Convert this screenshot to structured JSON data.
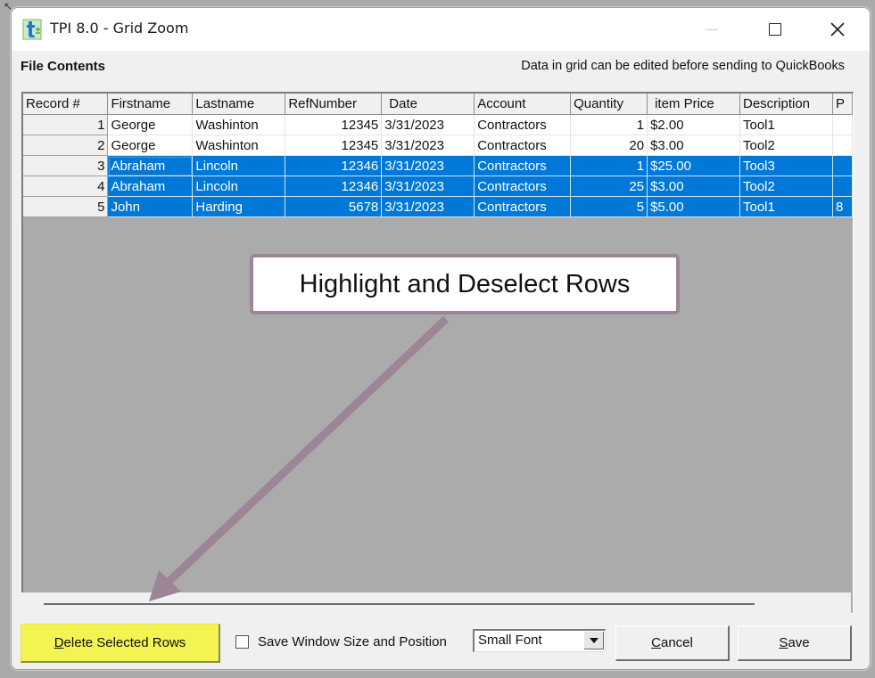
{
  "window": {
    "title": "TPI 8.0 - Grid Zoom",
    "icons": {
      "app": "tpi-app-icon",
      "minimize": "minimize-icon",
      "maximize": "maximize-icon",
      "close": "close-icon"
    },
    "close_glyph": "✕"
  },
  "header": {
    "heading": "File Contents",
    "note": "Data in grid can be edited before sending to QuickBooks"
  },
  "grid": {
    "columns": [
      "Record #",
      "Firstname",
      "Lastname",
      "RefNumber",
      "Date",
      "Account",
      "Quantity",
      "item Price",
      "Description",
      "P"
    ],
    "rows": [
      {
        "record": "1",
        "firstname": "George",
        "lastname": "Washinton",
        "refnumber": "12345",
        "date": "3/31/2023",
        "account": "Contractors",
        "quantity": "1",
        "price": "$2.00",
        "description": "Tool1",
        "p": "",
        "selected": false
      },
      {
        "record": "2",
        "firstname": "George",
        "lastname": "Washinton",
        "refnumber": "12345",
        "date": "3/31/2023",
        "account": "Contractors",
        "quantity": "20",
        "price": "$3.00",
        "description": "Tool2",
        "p": "",
        "selected": false
      },
      {
        "record": "3",
        "firstname": "Abraham",
        "lastname": "Lincoln",
        "refnumber": "12346",
        "date": "3/31/2023",
        "account": "Contractors",
        "quantity": "1",
        "price": "$25.00",
        "description": "Tool3",
        "p": "",
        "selected": true
      },
      {
        "record": "4",
        "firstname": "Abraham",
        "lastname": "Lincoln",
        "refnumber": "12346",
        "date": "3/31/2023",
        "account": "Contractors",
        "quantity": "25",
        "price": "$3.00",
        "description": "Tool2",
        "p": "",
        "selected": true
      },
      {
        "record": "5",
        "firstname": "John",
        "lastname": "Harding",
        "refnumber": "5678",
        "date": "3/31/2023",
        "account": "Contractors",
        "quantity": "5",
        "price": "$5.00",
        "description": "Tool1",
        "p": "8",
        "selected": true
      }
    ],
    "selection_color": "#0078d7"
  },
  "annotation": {
    "callout_text": "Highlight and Deselect Rows",
    "color": "#9d8598"
  },
  "footer": {
    "delete_button": {
      "mnemonic": "D",
      "rest": "elete Selected Rows",
      "highlight_color": "#f3f352"
    },
    "save_window_checkbox": {
      "label": "Save Window Size and Position",
      "checked": false
    },
    "font_select": {
      "value": "Small Font"
    },
    "cancel_button": {
      "mnemonic": "C",
      "rest": "ancel"
    },
    "save_button": {
      "mnemonic": "S",
      "rest": "ave"
    }
  }
}
